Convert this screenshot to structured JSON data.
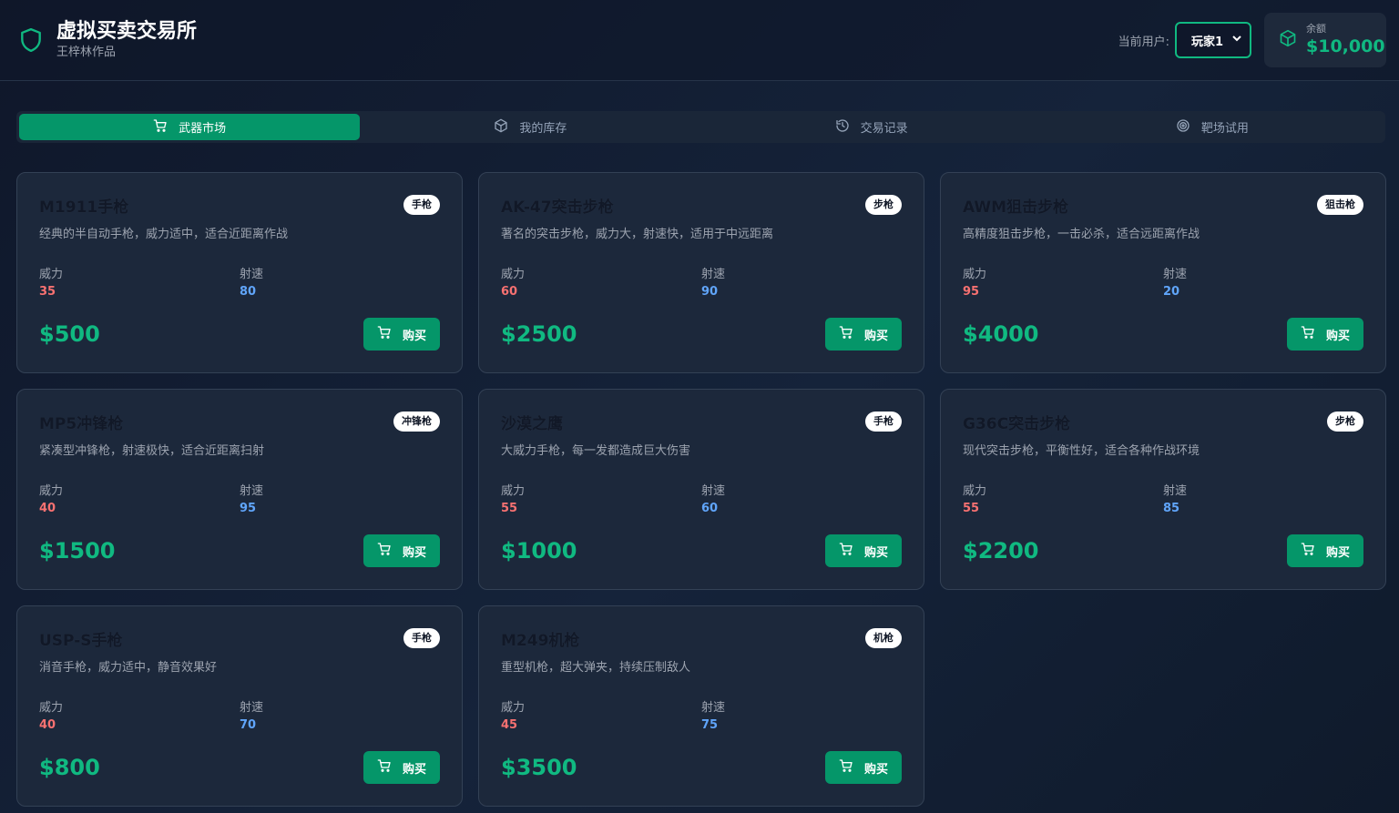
{
  "header": {
    "title": "虚拟买卖交易所",
    "subtitle": "王梓林作品",
    "user_label": "当前用户:",
    "user_value": "玩家1",
    "balance_label": "余额",
    "balance_value": "$10,000"
  },
  "tabs": [
    {
      "label": "武器市场",
      "icon": "cart-icon",
      "active": true
    },
    {
      "label": "我的库存",
      "icon": "box-icon",
      "active": false
    },
    {
      "label": "交易记录",
      "icon": "history-icon",
      "active": false
    },
    {
      "label": "靶场试用",
      "icon": "target-icon",
      "active": false
    }
  ],
  "market": {
    "power_label": "威力",
    "speed_label": "射速",
    "buy_label": "购买",
    "weapons": [
      {
        "name": "M1911手枪",
        "type": "手枪",
        "desc": "经典的半自动手枪，威力适中，适合近距离作战",
        "power": "35",
        "speed": "80",
        "price": "$500"
      },
      {
        "name": "AK-47突击步枪",
        "type": "步枪",
        "desc": "著名的突击步枪，威力大，射速快，适用于中远距离",
        "power": "60",
        "speed": "90",
        "price": "$2500"
      },
      {
        "name": "AWM狙击步枪",
        "type": "狙击枪",
        "desc": "高精度狙击步枪，一击必杀，适合远距离作战",
        "power": "95",
        "speed": "20",
        "price": "$4000"
      },
      {
        "name": "MP5冲锋枪",
        "type": "冲锋枪",
        "desc": "紧凑型冲锋枪，射速极快，适合近距离扫射",
        "power": "40",
        "speed": "95",
        "price": "$1500"
      },
      {
        "name": "沙漠之鹰",
        "type": "手枪",
        "desc": "大威力手枪，每一发都造成巨大伤害",
        "power": "55",
        "speed": "60",
        "price": "$1000"
      },
      {
        "name": "G36C突击步枪",
        "type": "步枪",
        "desc": "现代突击步枪，平衡性好，适合各种作战环境",
        "power": "55",
        "speed": "85",
        "price": "$2200"
      },
      {
        "name": "USP-S手枪",
        "type": "手枪",
        "desc": "消音手枪，威力适中，静音效果好",
        "power": "40",
        "speed": "70",
        "price": "$800"
      },
      {
        "name": "M249机枪",
        "type": "机枪",
        "desc": "重型机枪，超大弹夹，持续压制敌人",
        "power": "45",
        "speed": "75",
        "price": "$3500"
      }
    ]
  },
  "colors": {
    "accent": "#10b981",
    "power": "#f87171",
    "speed": "#60a5fa"
  }
}
